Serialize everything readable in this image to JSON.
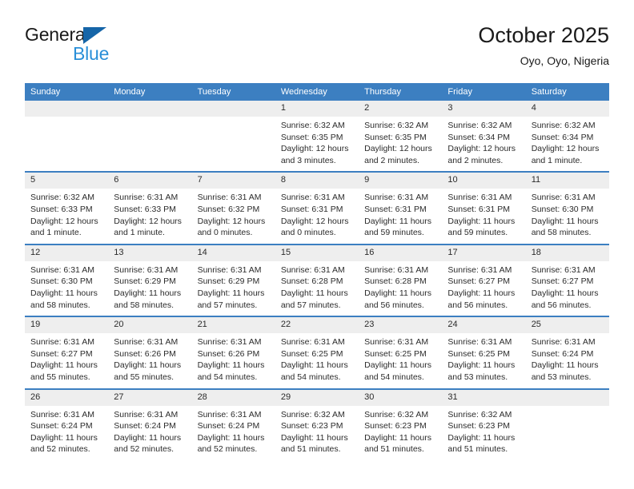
{
  "brand": {
    "word1": "General",
    "word2": "Blue",
    "triangle_color": "#1565a8",
    "blue_color": "#2a8fd8"
  },
  "header": {
    "title": "October 2025",
    "subtitle": "Oyo, Oyo, Nigeria"
  },
  "colors": {
    "header_bar": "#3c7fc1",
    "date_band": "#eeeeee",
    "text": "#2b2b2b"
  },
  "weekdays": [
    "Sunday",
    "Monday",
    "Tuesday",
    "Wednesday",
    "Thursday",
    "Friday",
    "Saturday"
  ],
  "weeks": [
    [
      {
        "day": "",
        "empty": true
      },
      {
        "day": "",
        "empty": true
      },
      {
        "day": "",
        "empty": true
      },
      {
        "day": "1",
        "sunrise": "Sunrise: 6:32 AM",
        "sunset": "Sunset: 6:35 PM",
        "daylight1": "Daylight: 12 hours",
        "daylight2": "and 3 minutes."
      },
      {
        "day": "2",
        "sunrise": "Sunrise: 6:32 AM",
        "sunset": "Sunset: 6:35 PM",
        "daylight1": "Daylight: 12 hours",
        "daylight2": "and 2 minutes."
      },
      {
        "day": "3",
        "sunrise": "Sunrise: 6:32 AM",
        "sunset": "Sunset: 6:34 PM",
        "daylight1": "Daylight: 12 hours",
        "daylight2": "and 2 minutes."
      },
      {
        "day": "4",
        "sunrise": "Sunrise: 6:32 AM",
        "sunset": "Sunset: 6:34 PM",
        "daylight1": "Daylight: 12 hours",
        "daylight2": "and 1 minute."
      }
    ],
    [
      {
        "day": "5",
        "sunrise": "Sunrise: 6:32 AM",
        "sunset": "Sunset: 6:33 PM",
        "daylight1": "Daylight: 12 hours",
        "daylight2": "and 1 minute."
      },
      {
        "day": "6",
        "sunrise": "Sunrise: 6:31 AM",
        "sunset": "Sunset: 6:33 PM",
        "daylight1": "Daylight: 12 hours",
        "daylight2": "and 1 minute."
      },
      {
        "day": "7",
        "sunrise": "Sunrise: 6:31 AM",
        "sunset": "Sunset: 6:32 PM",
        "daylight1": "Daylight: 12 hours",
        "daylight2": "and 0 minutes."
      },
      {
        "day": "8",
        "sunrise": "Sunrise: 6:31 AM",
        "sunset": "Sunset: 6:31 PM",
        "daylight1": "Daylight: 12 hours",
        "daylight2": "and 0 minutes."
      },
      {
        "day": "9",
        "sunrise": "Sunrise: 6:31 AM",
        "sunset": "Sunset: 6:31 PM",
        "daylight1": "Daylight: 11 hours",
        "daylight2": "and 59 minutes."
      },
      {
        "day": "10",
        "sunrise": "Sunrise: 6:31 AM",
        "sunset": "Sunset: 6:31 PM",
        "daylight1": "Daylight: 11 hours",
        "daylight2": "and 59 minutes."
      },
      {
        "day": "11",
        "sunrise": "Sunrise: 6:31 AM",
        "sunset": "Sunset: 6:30 PM",
        "daylight1": "Daylight: 11 hours",
        "daylight2": "and 58 minutes."
      }
    ],
    [
      {
        "day": "12",
        "sunrise": "Sunrise: 6:31 AM",
        "sunset": "Sunset: 6:30 PM",
        "daylight1": "Daylight: 11 hours",
        "daylight2": "and 58 minutes."
      },
      {
        "day": "13",
        "sunrise": "Sunrise: 6:31 AM",
        "sunset": "Sunset: 6:29 PM",
        "daylight1": "Daylight: 11 hours",
        "daylight2": "and 58 minutes."
      },
      {
        "day": "14",
        "sunrise": "Sunrise: 6:31 AM",
        "sunset": "Sunset: 6:29 PM",
        "daylight1": "Daylight: 11 hours",
        "daylight2": "and 57 minutes."
      },
      {
        "day": "15",
        "sunrise": "Sunrise: 6:31 AM",
        "sunset": "Sunset: 6:28 PM",
        "daylight1": "Daylight: 11 hours",
        "daylight2": "and 57 minutes."
      },
      {
        "day": "16",
        "sunrise": "Sunrise: 6:31 AM",
        "sunset": "Sunset: 6:28 PM",
        "daylight1": "Daylight: 11 hours",
        "daylight2": "and 56 minutes."
      },
      {
        "day": "17",
        "sunrise": "Sunrise: 6:31 AM",
        "sunset": "Sunset: 6:27 PM",
        "daylight1": "Daylight: 11 hours",
        "daylight2": "and 56 minutes."
      },
      {
        "day": "18",
        "sunrise": "Sunrise: 6:31 AM",
        "sunset": "Sunset: 6:27 PM",
        "daylight1": "Daylight: 11 hours",
        "daylight2": "and 56 minutes."
      }
    ],
    [
      {
        "day": "19",
        "sunrise": "Sunrise: 6:31 AM",
        "sunset": "Sunset: 6:27 PM",
        "daylight1": "Daylight: 11 hours",
        "daylight2": "and 55 minutes."
      },
      {
        "day": "20",
        "sunrise": "Sunrise: 6:31 AM",
        "sunset": "Sunset: 6:26 PM",
        "daylight1": "Daylight: 11 hours",
        "daylight2": "and 55 minutes."
      },
      {
        "day": "21",
        "sunrise": "Sunrise: 6:31 AM",
        "sunset": "Sunset: 6:26 PM",
        "daylight1": "Daylight: 11 hours",
        "daylight2": "and 54 minutes."
      },
      {
        "day": "22",
        "sunrise": "Sunrise: 6:31 AM",
        "sunset": "Sunset: 6:25 PM",
        "daylight1": "Daylight: 11 hours",
        "daylight2": "and 54 minutes."
      },
      {
        "day": "23",
        "sunrise": "Sunrise: 6:31 AM",
        "sunset": "Sunset: 6:25 PM",
        "daylight1": "Daylight: 11 hours",
        "daylight2": "and 54 minutes."
      },
      {
        "day": "24",
        "sunrise": "Sunrise: 6:31 AM",
        "sunset": "Sunset: 6:25 PM",
        "daylight1": "Daylight: 11 hours",
        "daylight2": "and 53 minutes."
      },
      {
        "day": "25",
        "sunrise": "Sunrise: 6:31 AM",
        "sunset": "Sunset: 6:24 PM",
        "daylight1": "Daylight: 11 hours",
        "daylight2": "and 53 minutes."
      }
    ],
    [
      {
        "day": "26",
        "sunrise": "Sunrise: 6:31 AM",
        "sunset": "Sunset: 6:24 PM",
        "daylight1": "Daylight: 11 hours",
        "daylight2": "and 52 minutes."
      },
      {
        "day": "27",
        "sunrise": "Sunrise: 6:31 AM",
        "sunset": "Sunset: 6:24 PM",
        "daylight1": "Daylight: 11 hours",
        "daylight2": "and 52 minutes."
      },
      {
        "day": "28",
        "sunrise": "Sunrise: 6:31 AM",
        "sunset": "Sunset: 6:24 PM",
        "daylight1": "Daylight: 11 hours",
        "daylight2": "and 52 minutes."
      },
      {
        "day": "29",
        "sunrise": "Sunrise: 6:32 AM",
        "sunset": "Sunset: 6:23 PM",
        "daylight1": "Daylight: 11 hours",
        "daylight2": "and 51 minutes."
      },
      {
        "day": "30",
        "sunrise": "Sunrise: 6:32 AM",
        "sunset": "Sunset: 6:23 PM",
        "daylight1": "Daylight: 11 hours",
        "daylight2": "and 51 minutes."
      },
      {
        "day": "31",
        "sunrise": "Sunrise: 6:32 AM",
        "sunset": "Sunset: 6:23 PM",
        "daylight1": "Daylight: 11 hours",
        "daylight2": "and 51 minutes."
      },
      {
        "day": "",
        "empty": true
      }
    ]
  ]
}
